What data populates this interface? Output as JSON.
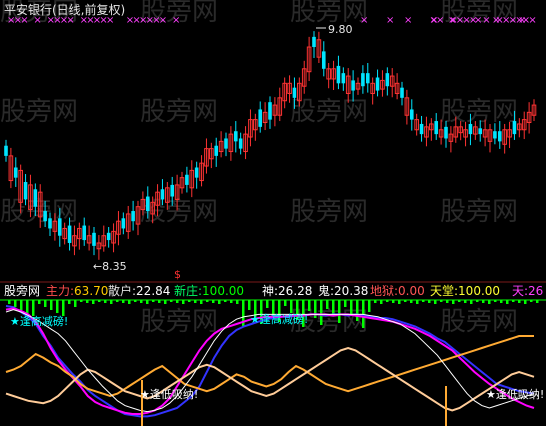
{
  "colors": {
    "up": "#ff3333",
    "down": "#00e5ff",
    "pink_mark": "#ff40ff",
    "green": "#00ff00",
    "magenta": "#ff00ff",
    "blue": "#3333ff",
    "white": "#ffffff",
    "orange": "#ffaa33",
    "peach": "#ffcc99",
    "cyan_text": "#00ffff",
    "yellow": "#ffff00"
  },
  "watermark": "股旁网",
  "chart_data": [
    {
      "type": "candlestick",
      "title": "平安银行(日线,前复权)",
      "high_label": "9.80",
      "low_label": "8.35",
      "ylim": [
        8.2,
        9.95
      ],
      "up_days": [
        1,
        3,
        5,
        7,
        10,
        12,
        14,
        15,
        17,
        19,
        20,
        22,
        23,
        25,
        27,
        28,
        30,
        31,
        33,
        35,
        36,
        38,
        40,
        41,
        42,
        44,
        46,
        49,
        50,
        51,
        53,
        55,
        56,
        57,
        58,
        60,
        61,
        62,
        64,
        66,
        67,
        70,
        72,
        75,
        77,
        79,
        80,
        82,
        84,
        86,
        87,
        89,
        91,
        92,
        93,
        94,
        96,
        98,
        99,
        102,
        103,
        105,
        106,
        107,
        108
      ],
      "close": [
        9.0,
        8.85,
        8.9,
        8.7,
        8.8,
        8.65,
        8.75,
        8.6,
        8.55,
        8.5,
        8.55,
        8.45,
        8.5,
        8.4,
        8.45,
        8.5,
        8.42,
        8.45,
        8.38,
        8.4,
        8.45,
        8.42,
        8.48,
        8.55,
        8.5,
        8.6,
        8.55,
        8.65,
        8.7,
        8.62,
        8.68,
        8.75,
        8.7,
        8.78,
        8.72,
        8.8,
        8.85,
        8.8,
        8.9,
        8.85,
        8.95,
        9.05,
        9.0,
        9.05,
        9.1,
        9.05,
        9.15,
        9.1,
        9.05,
        9.15,
        9.25,
        9.2,
        9.3,
        9.25,
        9.35,
        9.3,
        9.4,
        9.5,
        9.45,
        9.4,
        9.5,
        9.6,
        9.75,
        9.8,
        9.7,
        9.6,
        9.55,
        9.6,
        9.5,
        9.55,
        9.45,
        9.5,
        9.48,
        9.55,
        9.5,
        9.45,
        9.52,
        9.48,
        9.55,
        9.5,
        9.45,
        9.4,
        9.3,
        9.25,
        9.2,
        9.15,
        9.2,
        9.22,
        9.15,
        9.18,
        9.12,
        9.15,
        9.2,
        9.18,
        9.15,
        9.2,
        9.17,
        9.15,
        9.18,
        9.12,
        9.15,
        9.1,
        9.18,
        9.15,
        9.22,
        9.2,
        9.25,
        9.3,
        9.35
      ]
    },
    {
      "type": "line",
      "name": "逢高减磅",
      "readout": [
        {
          "label": "股旁网",
          "value": ""
        },
        {
          "label": "主力:",
          "value": "63.70"
        },
        {
          "label": "散户:",
          "value": "22.84"
        },
        {
          "label": "新庄:",
          "value": "100.00"
        },
        {
          "label": "神:",
          "value": "26.28"
        },
        {
          "label": "鬼:",
          "value": "20.38"
        },
        {
          "label": "地狱:",
          "value": "0.00"
        },
        {
          "label": "天堂:",
          "value": "100.00"
        },
        {
          "label": "天:",
          "value": "26"
        }
      ],
      "signal_char": "$",
      "annotations": [
        "逢高减磅!",
        "逢高减磅!",
        "逢低吸纳!",
        "逢低吸纳!"
      ],
      "ylim": [
        0,
        100
      ],
      "series": [
        {
          "name": "主力",
          "color": "blue",
          "values": [
            95,
            94,
            90,
            86,
            80,
            70,
            62,
            52,
            45,
            38,
            32,
            25,
            20,
            16,
            12,
            8,
            5,
            4,
            3,
            3,
            4,
            6,
            8,
            10,
            15,
            20,
            28,
            40,
            52,
            62,
            70,
            75,
            78,
            80,
            82,
            84,
            85,
            86,
            86,
            87,
            87,
            88,
            88,
            87,
            88,
            88,
            87,
            88,
            87,
            86,
            85,
            85,
            84,
            82,
            80,
            78,
            75,
            72,
            68,
            65,
            60,
            55,
            50,
            45,
            40,
            35,
            30,
            28,
            26,
            24,
            23,
            22
          ]
        },
        {
          "name": "散户",
          "color": "magenta",
          "values": [
            92,
            93,
            91,
            88,
            82,
            72,
            60,
            50,
            42,
            35,
            28,
            20,
            15,
            12,
            10,
            8,
            6,
            5,
            5,
            6,
            8,
            12,
            18,
            28,
            38,
            48,
            58,
            66,
            72,
            76,
            78,
            80,
            82,
            84,
            85,
            86,
            86,
            86,
            87,
            87,
            87,
            88,
            88,
            88,
            87,
            88,
            88,
            87,
            86,
            85,
            84,
            83,
            82,
            80,
            78,
            76,
            73,
            70,
            66,
            62,
            58,
            52,
            46,
            40,
            35,
            30,
            26,
            22,
            18,
            15,
            12,
            10
          ]
        },
        {
          "name": "神",
          "color": "orange",
          "values": [
            40,
            42,
            45,
            50,
            55,
            52,
            48,
            45,
            40,
            36,
            30,
            26,
            24,
            22,
            20,
            22,
            26,
            30,
            34,
            38,
            42,
            45,
            40,
            35,
            30,
            28,
            26,
            24,
            26,
            30,
            34,
            38,
            36,
            32,
            30,
            28,
            30,
            34,
            40,
            45,
            42,
            38,
            34,
            30,
            28,
            26,
            24,
            26,
            28,
            30,
            32,
            34,
            36,
            38,
            40,
            42,
            44,
            46,
            48,
            50,
            52,
            54,
            56,
            58,
            60,
            62,
            64,
            66,
            68,
            70,
            70,
            70
          ]
        },
        {
          "name": "鬼",
          "color": "peach",
          "values": [
            22,
            20,
            18,
            16,
            15,
            14,
            16,
            20,
            26,
            32,
            38,
            42,
            40,
            36,
            32,
            28,
            24,
            22,
            20,
            18,
            20,
            24,
            28,
            32,
            36,
            40,
            44,
            46,
            44,
            40,
            36,
            32,
            28,
            24,
            22,
            20,
            22,
            26,
            30,
            34,
            38,
            42,
            46,
            50,
            54,
            58,
            60,
            58,
            54,
            50,
            46,
            42,
            38,
            34,
            30,
            26,
            22,
            18,
            14,
            10,
            8,
            10,
            14,
            18,
            22,
            26,
            30,
            34,
            38,
            40,
            38,
            36
          ]
        },
        {
          "name": "散户(细)",
          "color": "white",
          "values": [
            90,
            92,
            90,
            87,
            84,
            80,
            76,
            72,
            66,
            58,
            50,
            42,
            35,
            28,
            22,
            16,
            12,
            10,
            8,
            7,
            8,
            10,
            14,
            20,
            28,
            36,
            46,
            56,
            66,
            74,
            80,
            84,
            86,
            87,
            88,
            88,
            88,
            88,
            88,
            88,
            88,
            88,
            88,
            88,
            88,
            88,
            88,
            88,
            88,
            87,
            86,
            84,
            82,
            80,
            76,
            72,
            66,
            60,
            54,
            46,
            38,
            30,
            22,
            16,
            12,
            10,
            12,
            14,
            16,
            18,
            20,
            22
          ]
        }
      ]
    }
  ]
}
